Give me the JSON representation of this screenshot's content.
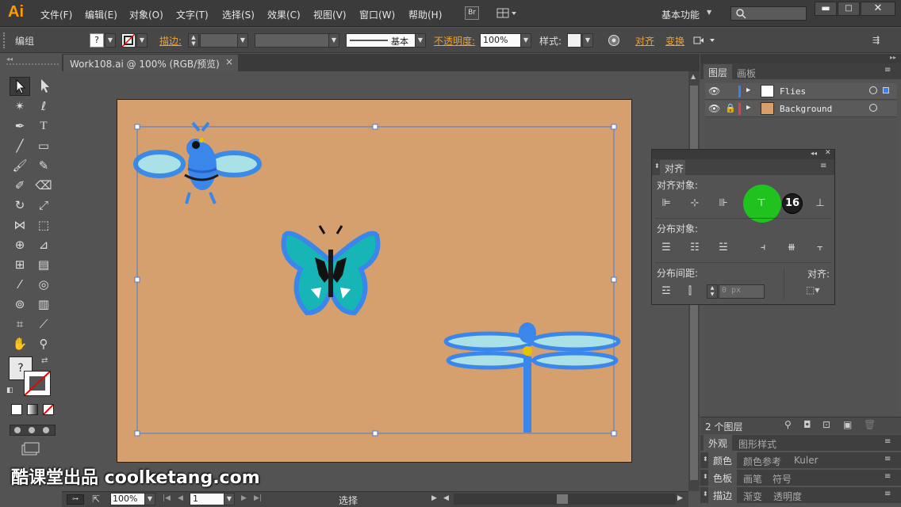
{
  "app": {
    "logo": "Ai"
  },
  "menu": [
    "文件(F)",
    "编辑(E)",
    "对象(O)",
    "文字(T)",
    "选择(S)",
    "效果(C)",
    "视图(V)",
    "窗口(W)",
    "帮助(H)"
  ],
  "bridge_label": "Br",
  "workspace": "基本功能",
  "search": {
    "placeholder": ""
  },
  "control": {
    "selection_label": "编组",
    "stroke_label": "描边:",
    "stroke_style": "基本",
    "opacity_label": "不透明度:",
    "opacity_value": "100%",
    "style_label": "样式:",
    "align_label": "对齐",
    "transform_label": "变换",
    "fill_question": "?"
  },
  "document": {
    "tab_title": "Work108.ai @ 100% (RGB/预览)",
    "close": "×"
  },
  "status": {
    "zoom": "100%",
    "page": "1",
    "tool": "选择"
  },
  "layers_panel": {
    "tabs": [
      "图层",
      "画板"
    ],
    "layers": [
      {
        "name": "Flies",
        "color": "#3b7ff5"
      },
      {
        "name": "Background",
        "color": "#e34040"
      }
    ],
    "count": "2 个图层"
  },
  "align_panel": {
    "title": "对齐",
    "section_align": "对齐对象:",
    "section_distribute": "分布对象:",
    "section_spacing": "分布间距:",
    "align_to_label": "对齐:",
    "spacing_value": "0 px",
    "step_badge": "16",
    "highlight_color": "#1fc21f"
  },
  "stacked_panels": [
    {
      "tabs": [
        "外观",
        "图形样式"
      ]
    },
    {
      "tabs": [
        "颜色",
        "颜色参考",
        "Kuler"
      ]
    },
    {
      "tabs": [
        "色板",
        "画笔",
        "符号"
      ]
    },
    {
      "tabs": [
        "描边",
        "渐变",
        "透明度"
      ]
    }
  ],
  "watermark": "酷课堂出品 coolketang.com",
  "artboard_color": "#d5a06e",
  "selection_color": "#4a7bd4"
}
